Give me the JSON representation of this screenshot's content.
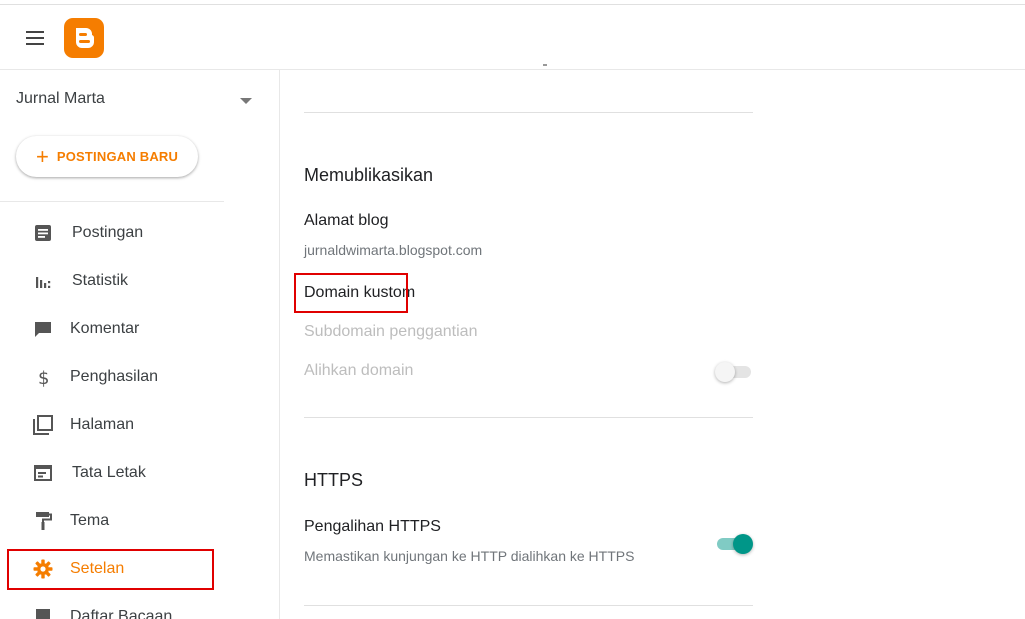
{
  "header": {
    "logo": "blogger-logo"
  },
  "sidebar": {
    "blog_name": "Jurnal Marta",
    "new_post_label": "POSTINGAN BARU",
    "items": [
      {
        "label": "Postingan",
        "icon": "posts-icon"
      },
      {
        "label": "Statistik",
        "icon": "stats-icon"
      },
      {
        "label": "Komentar",
        "icon": "comment-icon"
      },
      {
        "label": "Penghasilan",
        "icon": "dollar-icon"
      },
      {
        "label": "Halaman",
        "icon": "pages-icon"
      },
      {
        "label": "Tata Letak",
        "icon": "layout-icon"
      },
      {
        "label": "Tema",
        "icon": "paint-roller-icon"
      },
      {
        "label": "Setelan",
        "icon": "gear-icon",
        "active": true
      },
      {
        "label": "Daftar Bacaan",
        "icon": "bookmark-icon"
      }
    ]
  },
  "publishing": {
    "title": "Memublikasikan",
    "blog_address_label": "Alamat blog",
    "blog_address_value": "jurnaldwimarta.blogspot.com",
    "custom_domain_label": "Domain kustom",
    "fallback_subdomain_label": "Subdomain penggantian",
    "redirect_domain_label": "Alihkan domain",
    "redirect_domain_enabled": false
  },
  "https": {
    "title": "HTTPS",
    "redirect_label": "Pengalihan HTTPS",
    "redirect_desc": "Memastikan kunjungan ke HTTP dialihkan ke HTTPS",
    "redirect_enabled": true
  },
  "colors": {
    "accent": "#f57d00",
    "toggle_on": "#009688",
    "highlight": "#e00000"
  }
}
